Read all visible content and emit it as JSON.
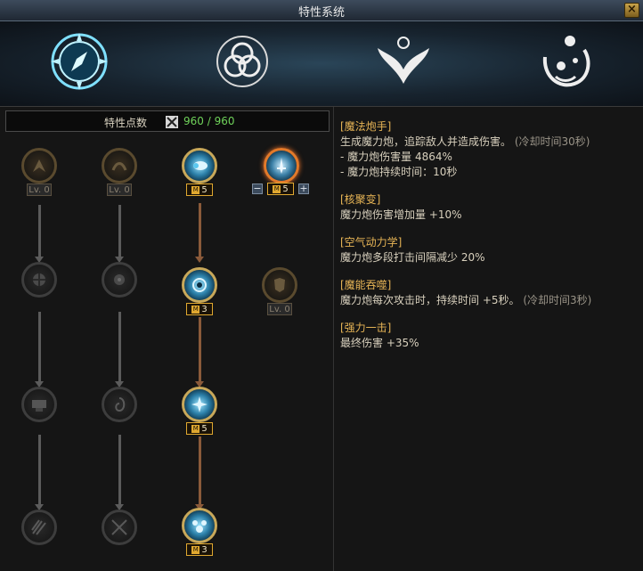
{
  "window": {
    "title": "特性系统",
    "close_label": "×"
  },
  "banner": {
    "emblems": [
      "compass-emblem",
      "trinity-knot-emblem",
      "winged-emblem",
      "magic-potion-emblem"
    ]
  },
  "points": {
    "label": "特性点数",
    "value": "960 / 960",
    "icon": "crossed-swords-icon"
  },
  "tree": {
    "columns": [
      {
        "nodes": [
          {
            "icon": "dragon-claw-icon",
            "level": "Lv. 0",
            "state": "locked"
          },
          {
            "icon": "shatter-icon",
            "state": "locked"
          },
          {
            "icon": "anvil-icon",
            "state": "locked"
          },
          {
            "icon": "claw-slash-icon",
            "state": "locked"
          }
        ]
      },
      {
        "nodes": [
          {
            "icon": "talon-icon",
            "level": "Lv. 0",
            "state": "locked"
          },
          {
            "icon": "burst-icon",
            "state": "locked"
          },
          {
            "icon": "vortex-icon",
            "state": "locked"
          },
          {
            "icon": "cross-slash-icon",
            "state": "locked"
          }
        ]
      },
      {
        "nodes": [
          {
            "icon": "magic-cannon-icon",
            "level": "5",
            "state": "active"
          },
          {
            "icon": "core-spiral-icon",
            "level": "3",
            "state": "active"
          },
          {
            "icon": "air-burst-icon",
            "level": "5",
            "state": "active"
          },
          {
            "icon": "energy-orbs-icon",
            "level": "3",
            "state": "active"
          }
        ]
      },
      {
        "nodes": [
          {
            "icon": "power-sword-icon",
            "level": "5",
            "state": "selected",
            "minus": "−",
            "plus": "+"
          },
          {
            "icon": "armor-icon",
            "level": "Lv. 0",
            "state": "locked"
          }
        ]
      }
    ]
  },
  "info": {
    "sections": [
      {
        "title": "[魔法炮手]",
        "lines": [
          "生成魔力炮，追踪敌人并造成伤害。",
          "(冷却时间30秒)",
          "- 魔力炮伤害量 4864%",
          "- 魔力炮持续时间：10秒"
        ]
      },
      {
        "title": "[核聚变]",
        "lines": [
          "魔力炮伤害增加量 +10%"
        ]
      },
      {
        "title": "[空气动力学]",
        "lines": [
          "魔力炮多段打击间隔减少 20%"
        ]
      },
      {
        "title": "[魔能吞噬]",
        "lines": [
          "魔力炮每次攻击时，持续时间 +5秒。",
          "(冷却时间3秒)"
        ]
      },
      {
        "title": "[强力一击]",
        "lines": [
          "最终伤害 +35%"
        ]
      }
    ]
  },
  "colors": {
    "accent_gold": "#e6b455",
    "points_green": "#6fd25a",
    "active_border": "#c8a85a",
    "selected_border": "#e37a2a"
  }
}
